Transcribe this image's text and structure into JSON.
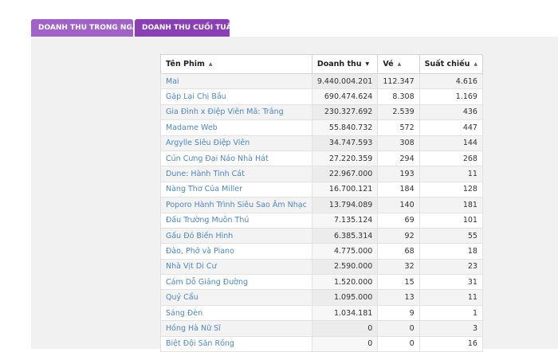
{
  "tabs": [
    {
      "label": "DOANH THU TRONG NGÀY"
    },
    {
      "label": "DOANH THU CUỐI TUẦN"
    }
  ],
  "columns": [
    {
      "label": "Tên Phim",
      "arrow": "▲"
    },
    {
      "label": "Doanh thu",
      "arrow": "▼"
    },
    {
      "label": "Vé",
      "arrow": "▲"
    },
    {
      "label": "Suất chiếu",
      "arrow": "▲"
    }
  ],
  "rows": [
    {
      "title": "Mai",
      "revenue": "9.440.004.201",
      "tickets": "112.347",
      "shows": "4.616"
    },
    {
      "title": "Gặp Lại Chị Bầu",
      "revenue": "690.474.624",
      "tickets": "8.308",
      "shows": "1.169"
    },
    {
      "title": "Gia Đình x Điệp Viên Mã: Trắng",
      "revenue": "230.327.692",
      "tickets": "2.539",
      "shows": "436"
    },
    {
      "title": "Madame Web",
      "revenue": "55.840.732",
      "tickets": "572",
      "shows": "447"
    },
    {
      "title": "Argylle Siêu Điệp Viên",
      "revenue": "34.747.593",
      "tickets": "308",
      "shows": "144"
    },
    {
      "title": "Cún Cưng Đại Náo Nhà Hát",
      "revenue": "27.220.359",
      "tickets": "294",
      "shows": "268"
    },
    {
      "title": "Dune: Hành Tinh Cát",
      "revenue": "22.967.000",
      "tickets": "193",
      "shows": "11"
    },
    {
      "title": "Nàng Thơ Của Miller",
      "revenue": "16.700.121",
      "tickets": "184",
      "shows": "128"
    },
    {
      "title": "Poporo Hành Trình Siêu Sao Âm Nhạc",
      "revenue": "13.794.089",
      "tickets": "140",
      "shows": "181"
    },
    {
      "title": "Đấu Trường Muôn Thú",
      "revenue": "7.135.124",
      "tickets": "69",
      "shows": "101"
    },
    {
      "title": "Gấu Đỏ Biến Hình",
      "revenue": "6.385.314",
      "tickets": "92",
      "shows": "55"
    },
    {
      "title": "Đào, Phở và Piano",
      "revenue": "4.775.000",
      "tickets": "68",
      "shows": "18"
    },
    {
      "title": "Nhà Vịt Di Cư",
      "revenue": "2.590.000",
      "tickets": "32",
      "shows": "23"
    },
    {
      "title": "Cám Dỗ Giảng Đường",
      "revenue": "1.520.000",
      "tickets": "15",
      "shows": "31"
    },
    {
      "title": "Quỷ Cẩu",
      "revenue": "1.095.000",
      "tickets": "13",
      "shows": "11"
    },
    {
      "title": "Sáng Đèn",
      "revenue": "1.034.181",
      "tickets": "9",
      "shows": "1"
    },
    {
      "title": "Hồng Hà Nữ Sĩ",
      "revenue": "0",
      "tickets": "0",
      "shows": "3"
    },
    {
      "title": "Biệt Đội Săn Rồng",
      "revenue": "0",
      "tickets": "0",
      "shows": "16"
    }
  ]
}
